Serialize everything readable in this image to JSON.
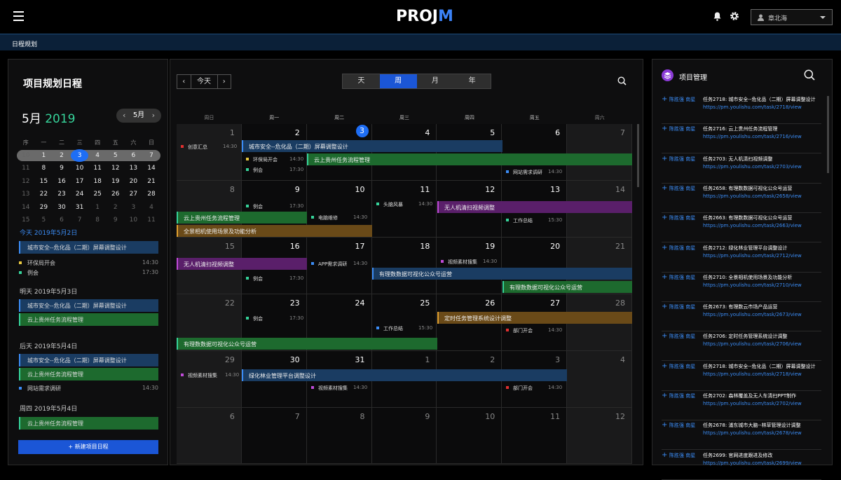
{
  "app": {
    "logo_main": "PROJ",
    "logo_accent": "M",
    "user": "章北海",
    "breadcrumb": "日程规划"
  },
  "left": {
    "title": "项目规划日程",
    "month": "5月",
    "year": "2019",
    "picker": "5月",
    "mini_header": [
      "序",
      "一",
      "二",
      "三",
      "四",
      "五",
      "六",
      "日"
    ],
    "mini_rows": [
      {
        "wk": "10",
        "days": [
          "1",
          "2",
          "3",
          "4",
          "5",
          "6",
          "7"
        ]
      },
      {
        "wk": "11",
        "days": [
          "8",
          "9",
          "10",
          "11",
          "12",
          "13",
          "14"
        ]
      },
      {
        "wk": "12",
        "days": [
          "15",
          "16",
          "17",
          "18",
          "19",
          "20",
          "21"
        ]
      },
      {
        "wk": "13",
        "days": [
          "22",
          "23",
          "24",
          "25",
          "26",
          "27",
          "28"
        ]
      },
      {
        "wk": "14",
        "days": [
          "29",
          "30",
          "31",
          "1",
          "2",
          "3",
          "4"
        ]
      },
      {
        "wk": "15",
        "days": [
          "5",
          "6",
          "7",
          "8",
          "9",
          "10",
          "11"
        ]
      }
    ],
    "today_label": "今天  2019年5月2日",
    "tomorrow_label": "明天  2019年5月3日",
    "after_label": "后天  2019年5月4日",
    "thu_label": "周四  2019年5月4日",
    "ev_city": "城市安全--危化品（二期）屏幕调整设计",
    "ev_cloud": "云上贵州任务流程管理",
    "ev_env": "环保局开会",
    "ev_env_time": "14:30",
    "ev_meet": "例会",
    "ev_meet_time": "17:30",
    "ev_net": "网站需求调研",
    "ev_net_time": "14:30",
    "new_btn": "+ 新建项目日程"
  },
  "mid": {
    "prev": "‹",
    "today": "今天",
    "next": "›",
    "views": [
      "天",
      "周",
      "月",
      "年"
    ],
    "weekdays": [
      "周日",
      "周一",
      "周二",
      "周三",
      "周四",
      "周五",
      "周六"
    ],
    "rows": [
      [
        "1",
        "2",
        "3",
        "4",
        "5",
        "6",
        "7"
      ],
      [
        "8",
        "9",
        "10",
        "11",
        "12",
        "13",
        "14"
      ],
      [
        "15",
        "16",
        "17",
        "18",
        "19",
        "20",
        "21"
      ],
      [
        "22",
        "23",
        "24",
        "25",
        "26",
        "27",
        "28"
      ],
      [
        "29",
        "30",
        "31",
        "1",
        "2",
        "3",
        "4"
      ],
      [
        "6",
        "7",
        "8",
        "9",
        "10",
        "11",
        "12"
      ]
    ],
    "e": {
      "cy": "创意汇总",
      "cy_t": "14:30",
      "city": "城市安全--危化品（二期）屏幕调整设计",
      "cloud": "云上贵州任务流程管理",
      "env": "环保局开会",
      "env_t": "14:30",
      "meet": "例会",
      "meet_t": "17:30",
      "net": "网站需求调研",
      "net_t": "14:30",
      "meet2": "例会",
      "meet2_t": "17:30",
      "brain": "头脑风暴",
      "brain_t": "14:30",
      "drone": "无人机清扫视频调整",
      "cloud2": "云上贵州任务流程管理",
      "pc": "电脑维修",
      "pc_t": "14:30",
      "work": "工作总结",
      "work_t": "15:30",
      "scene": "全景相机使用场景及功能分析",
      "drone2": "无人机清扫视频调整",
      "app": "APP需求调研",
      "app_t": "14:30",
      "vid": "视频素材搜集",
      "vid_t": "14:30",
      "wx": "有理数数据可视化公众号运营",
      "meet3": "例会",
      "meet3_t": "17:30",
      "wx2": "有理数数据可视化公众号运营",
      "meet4": "例会",
      "meet4_t": "17:30",
      "timer": "定时任务管理系统设计调整",
      "work2": "工作总结",
      "work2_t": "15:30",
      "dept": "部门开会",
      "dept_t": "14:30",
      "wx3": "有理数数据可视化公众号运营",
      "vid2": "视频素材搜集",
      "vid2_t": "14:30",
      "forest": "绿化林业管理平台调整设计",
      "vid3": "视频素材搜集",
      "vid3_t": "14:30",
      "dept2": "部门开会",
      "dept2_t": "14:30"
    }
  },
  "right": {
    "title": "项目管理",
    "who": "陈胜强  南星",
    "tasks": [
      {
        "name": "任务2718: 城市安全--危化品（二期）屏幕调整设计",
        "url": "https://pm.youlishu.com/task/2718/view"
      },
      {
        "name": "任务2716: 云上贵州任务流程管理",
        "url": "https://pm.youlishu.com/task/2716/view"
      },
      {
        "name": "任务2703: 无人机清扫视频调整",
        "url": "https://pm.youlishu.com/task/2703/view"
      },
      {
        "name": "任务2658: 有理数数据可视化公众号运营",
        "url": "https://pm.youlishu.com/task/2658/view"
      },
      {
        "name": "任务2663: 有理数数据可视化公众号运营",
        "url": "https://pm.youlishu.com/task/2663/view"
      },
      {
        "name": "任务2712: 绿化林业管理平台调整设计",
        "url": "https://pm.youlishu.com/task/2712/view"
      },
      {
        "name": "任务2710: 全景相机使用场景及功能分析",
        "url": "https://pm.youlishu.com/task/2710/view"
      },
      {
        "name": "任务2673: 有理数云市场产品运营",
        "url": "https://pm.youlishu.com/task/2673/view"
      },
      {
        "name": "任务2706: 定时任务管理系统设计调整",
        "url": "https://pm.youlishu.com/task/2706/view"
      },
      {
        "name": "任务2718: 城市安全--危化品（二期）屏幕调整设计",
        "url": "https://pm.youlishu.com/task/2718/view"
      },
      {
        "name": "任务2702: 森林覆盖及无人车清扫PPT制作",
        "url": "https://pm.youlishu.com/task/2702/view"
      },
      {
        "name": "任务2678: 浦东城市大脑--林草管理设计调整",
        "url": "https://pm.youlishu.com/task/2678/view"
      },
      {
        "name": "任务2699: 官网进度跟进及修改",
        "url": "https://pm.youlishu.com/task/2699/view"
      }
    ]
  },
  "colors": {
    "accent": "#1b56d6",
    "blue_event": "#1a3c62",
    "green_event": "#1d6a2e",
    "purple_event": "#5a1f6a",
    "orange_event": "#6a4a18"
  },
  "icons": [
    "menu-icon",
    "bell-icon",
    "gear-icon",
    "user-icon",
    "search-icon",
    "layers-icon"
  ]
}
